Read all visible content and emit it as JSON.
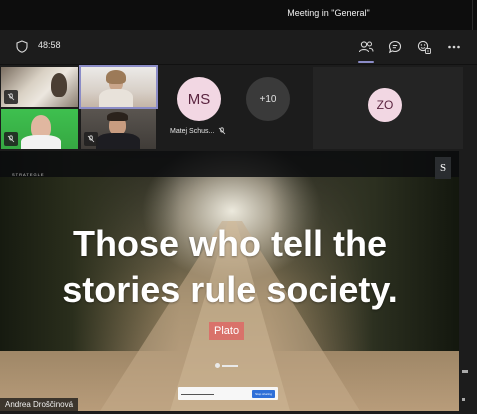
{
  "window": {
    "title": "Meeting in \"General\""
  },
  "toolbar": {
    "timer": "48:58",
    "icons": [
      "shield-icon",
      "people-icon",
      "chat-icon",
      "reactions-icon",
      "more-icon"
    ]
  },
  "participants": {
    "avatar_initials": "MS",
    "avatar_name": "Matej Schus...",
    "overflow_count": "+10",
    "side_initials": "ZO"
  },
  "shared_screen": {
    "brand": "STRATEGLE",
    "badge_letter": "S",
    "quote": "Those who tell the stories rule society.",
    "author": "Plato",
    "share_stop_label": "Stop sharing",
    "presenter_name": "Andrea Droščinová"
  },
  "colors": {
    "accent": "#8b8cc7",
    "avatar_bg": "#f2d7e3",
    "author_tag": "#d9726a",
    "stop_button": "#2e6fd8"
  }
}
